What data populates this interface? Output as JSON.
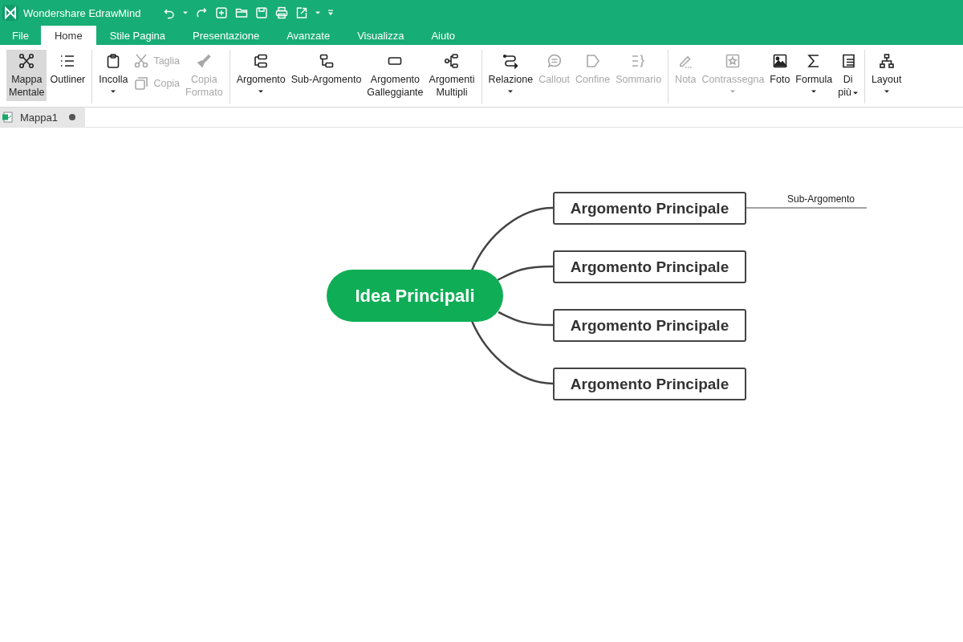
{
  "app": {
    "title": "Wondershare EdrawMind"
  },
  "menu_tabs": [
    {
      "label": "File",
      "selected": false
    },
    {
      "label": "Home",
      "selected": true
    },
    {
      "label": "Stile Pagina",
      "selected": false
    },
    {
      "label": "Presentazione",
      "selected": false
    },
    {
      "label": "Avanzate",
      "selected": false
    },
    {
      "label": "Visualizza",
      "selected": false
    },
    {
      "label": "Aiuto",
      "selected": false
    }
  ],
  "ribbon": {
    "groups": [
      {
        "buttons": [
          {
            "kind": "large",
            "label": "Mappa\nMentale",
            "selected": true,
            "disabled": false
          },
          {
            "kind": "large",
            "label": "Outliner",
            "selected": false,
            "disabled": false
          }
        ]
      },
      {
        "buttons": [
          {
            "kind": "large",
            "label": "Incolla",
            "disabled": false,
            "dropdown": true
          },
          {
            "kind": "small",
            "label": "Taglia",
            "disabled": true
          },
          {
            "kind": "small",
            "label": "Copia",
            "disabled": true
          },
          {
            "kind": "large",
            "label": "Copia\nFormato",
            "disabled": true
          }
        ]
      },
      {
        "buttons": [
          {
            "kind": "large",
            "label": "Argomento",
            "disabled": false,
            "dropdown": true
          },
          {
            "kind": "large",
            "label": "Sub-Argomento",
            "disabled": false
          },
          {
            "kind": "large",
            "label": "Argomento\nGalleggiante",
            "disabled": false
          },
          {
            "kind": "large",
            "label": "Argomenti\nMultipli",
            "disabled": false
          }
        ]
      },
      {
        "buttons": [
          {
            "kind": "large",
            "label": "Relazione",
            "disabled": false,
            "dropdown": true
          },
          {
            "kind": "large",
            "label": "Callout",
            "disabled": true
          },
          {
            "kind": "large",
            "label": "Confine",
            "disabled": true
          },
          {
            "kind": "large",
            "label": "Sommario",
            "disabled": true
          }
        ]
      },
      {
        "buttons": [
          {
            "kind": "large",
            "label": "Nota",
            "disabled": true
          },
          {
            "kind": "large",
            "label": "Contrassegna",
            "disabled": true,
            "dropdown": true
          },
          {
            "kind": "large",
            "label": "Foto",
            "disabled": false
          },
          {
            "kind": "large",
            "label": "Formula",
            "disabled": false,
            "dropdown": true
          },
          {
            "kind": "large",
            "label": "Di\npiù",
            "disabled": false,
            "dropdown": true
          }
        ]
      },
      {
        "buttons": [
          {
            "kind": "large",
            "label": "Layout",
            "disabled": false,
            "dropdown": true
          }
        ]
      }
    ]
  },
  "document_tabs": [
    {
      "label": "Mappa1",
      "unsaved": true,
      "selected": true
    }
  ],
  "mind_map": {
    "central": "Idea Principali",
    "topics": [
      {
        "label": "Argomento Principale",
        "children": [
          {
            "label": "Sub-Argomento"
          }
        ]
      },
      {
        "label": "Argomento Principale"
      },
      {
        "label": "Argomento Principale"
      },
      {
        "label": "Argomento Principale"
      }
    ]
  }
}
